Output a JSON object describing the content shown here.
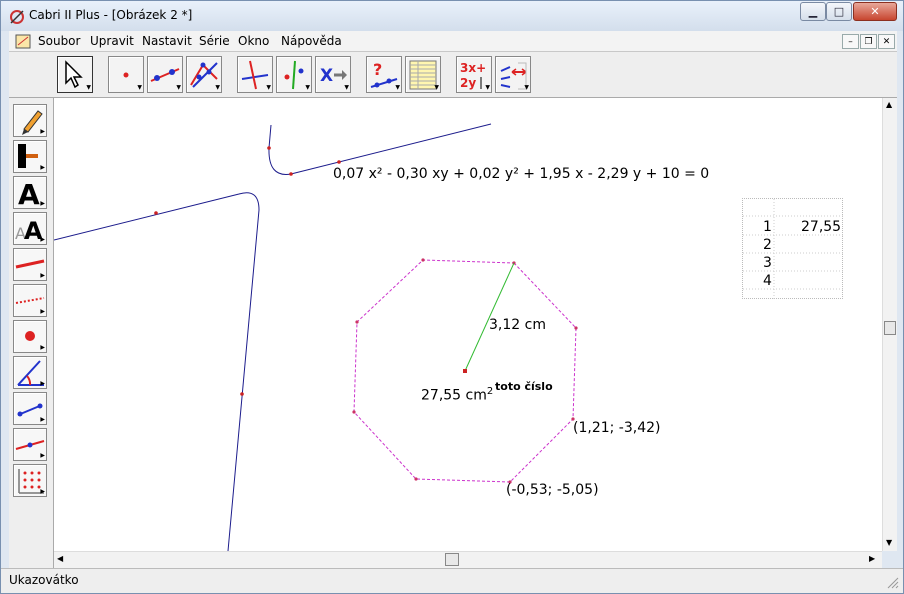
{
  "window": {
    "title": "Cabri II Plus - [Obrázek 2 *]"
  },
  "menu": [
    "Soubor",
    "Upravit",
    "Nastavit",
    "Série",
    "Okno",
    "Nápověda"
  ],
  "toolbar": {
    "tools": [
      "pointer",
      "point",
      "line",
      "curve",
      "construct",
      "transform",
      "macro",
      "check-property",
      "measure",
      "calculate",
      "display"
    ]
  },
  "canvas": {
    "equation": "0,07 x² - 0,30 xy + 0,02 y² + 1,95 x - 2,29 y + 10 = 0",
    "radius_label": "3,12 cm",
    "area_value": "27,55 cm",
    "area_exp": "2",
    "area_note": "toto číslo",
    "coord1": "(1,21; -3,42)",
    "coord2": "(-0,53; -5,05)"
  },
  "spreadsheet": {
    "rows": [
      {
        "n": "1",
        "v": "27,55"
      },
      {
        "n": "2",
        "v": ""
      },
      {
        "n": "3",
        "v": ""
      },
      {
        "n": "4",
        "v": ""
      }
    ]
  },
  "status": {
    "text": "Ukazovátko"
  },
  "colors": {
    "curve": "#1c1c8c",
    "polygon": "#cc33cc",
    "radius": "#33bb33",
    "point": "#cc2222"
  }
}
